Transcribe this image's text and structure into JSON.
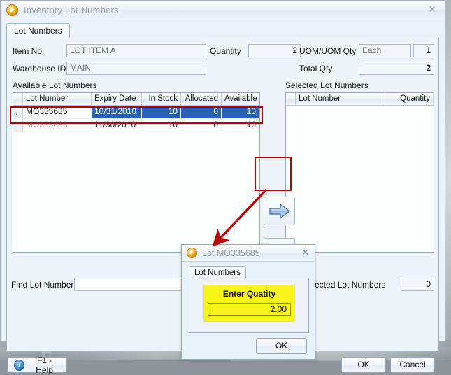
{
  "window": {
    "title": "Inventory Lot Numbers",
    "icon": "app-play-icon",
    "close_label": "✕",
    "tab": "Lot Numbers"
  },
  "form": {
    "item_no_label": "Item No.",
    "item_no_value": "LOT ITEM A",
    "warehouse_label": "Warehouse ID",
    "warehouse_value": "MAIN",
    "quantity_label": "Quantity",
    "quantity_value": "2",
    "uom_label": "UOM/UOM Qty",
    "uom_value": "Each",
    "uom_qty_value": "1",
    "total_qty_label": "Total Qty",
    "total_qty_value": "2"
  },
  "available": {
    "caption": "Available Lot Numbers",
    "columns": [
      "Lot Number",
      "Expiry Date",
      "In Stock",
      "Allocated",
      "Available"
    ],
    "sorted_column": "Lot Number",
    "rows": [
      {
        "caret": "›",
        "lot": "MO335685",
        "expiry": "10/31/2010",
        "in_stock": "10",
        "allocated": "0",
        "available": "10",
        "selected": true
      },
      {
        "caret": "",
        "lot": "MO335686",
        "expiry": "11/30/2010",
        "in_stock": "10",
        "allocated": "0",
        "available": "10",
        "selected": false
      }
    ]
  },
  "selected": {
    "caption": "Selected Lot Numbers",
    "columns": [
      "Lot Number",
      "Quantity"
    ],
    "sorted_column": "Lot Number",
    "rows": []
  },
  "transfer": {
    "move_right": "right-arrow-button",
    "move_left": "left-arrow-button"
  },
  "footer": {
    "find_label": "Find Lot Number",
    "find_value": "",
    "selected_count_label": "r of selected Lot Numbers",
    "selected_count_value": "0",
    "help_label": "F1 - Help",
    "help_icon": "?",
    "ok_label": "OK",
    "cancel_label": "Cancel"
  },
  "dialog": {
    "title": "Lot MO335685",
    "close_label": "✕",
    "tab": "Lot Numbers",
    "prompt": "Enter Quatity",
    "quantity_value": "2.00",
    "ok_label": "OK"
  },
  "annotation": {
    "highlight_color": "#c00000",
    "arrow_label": "callout-arrow"
  }
}
